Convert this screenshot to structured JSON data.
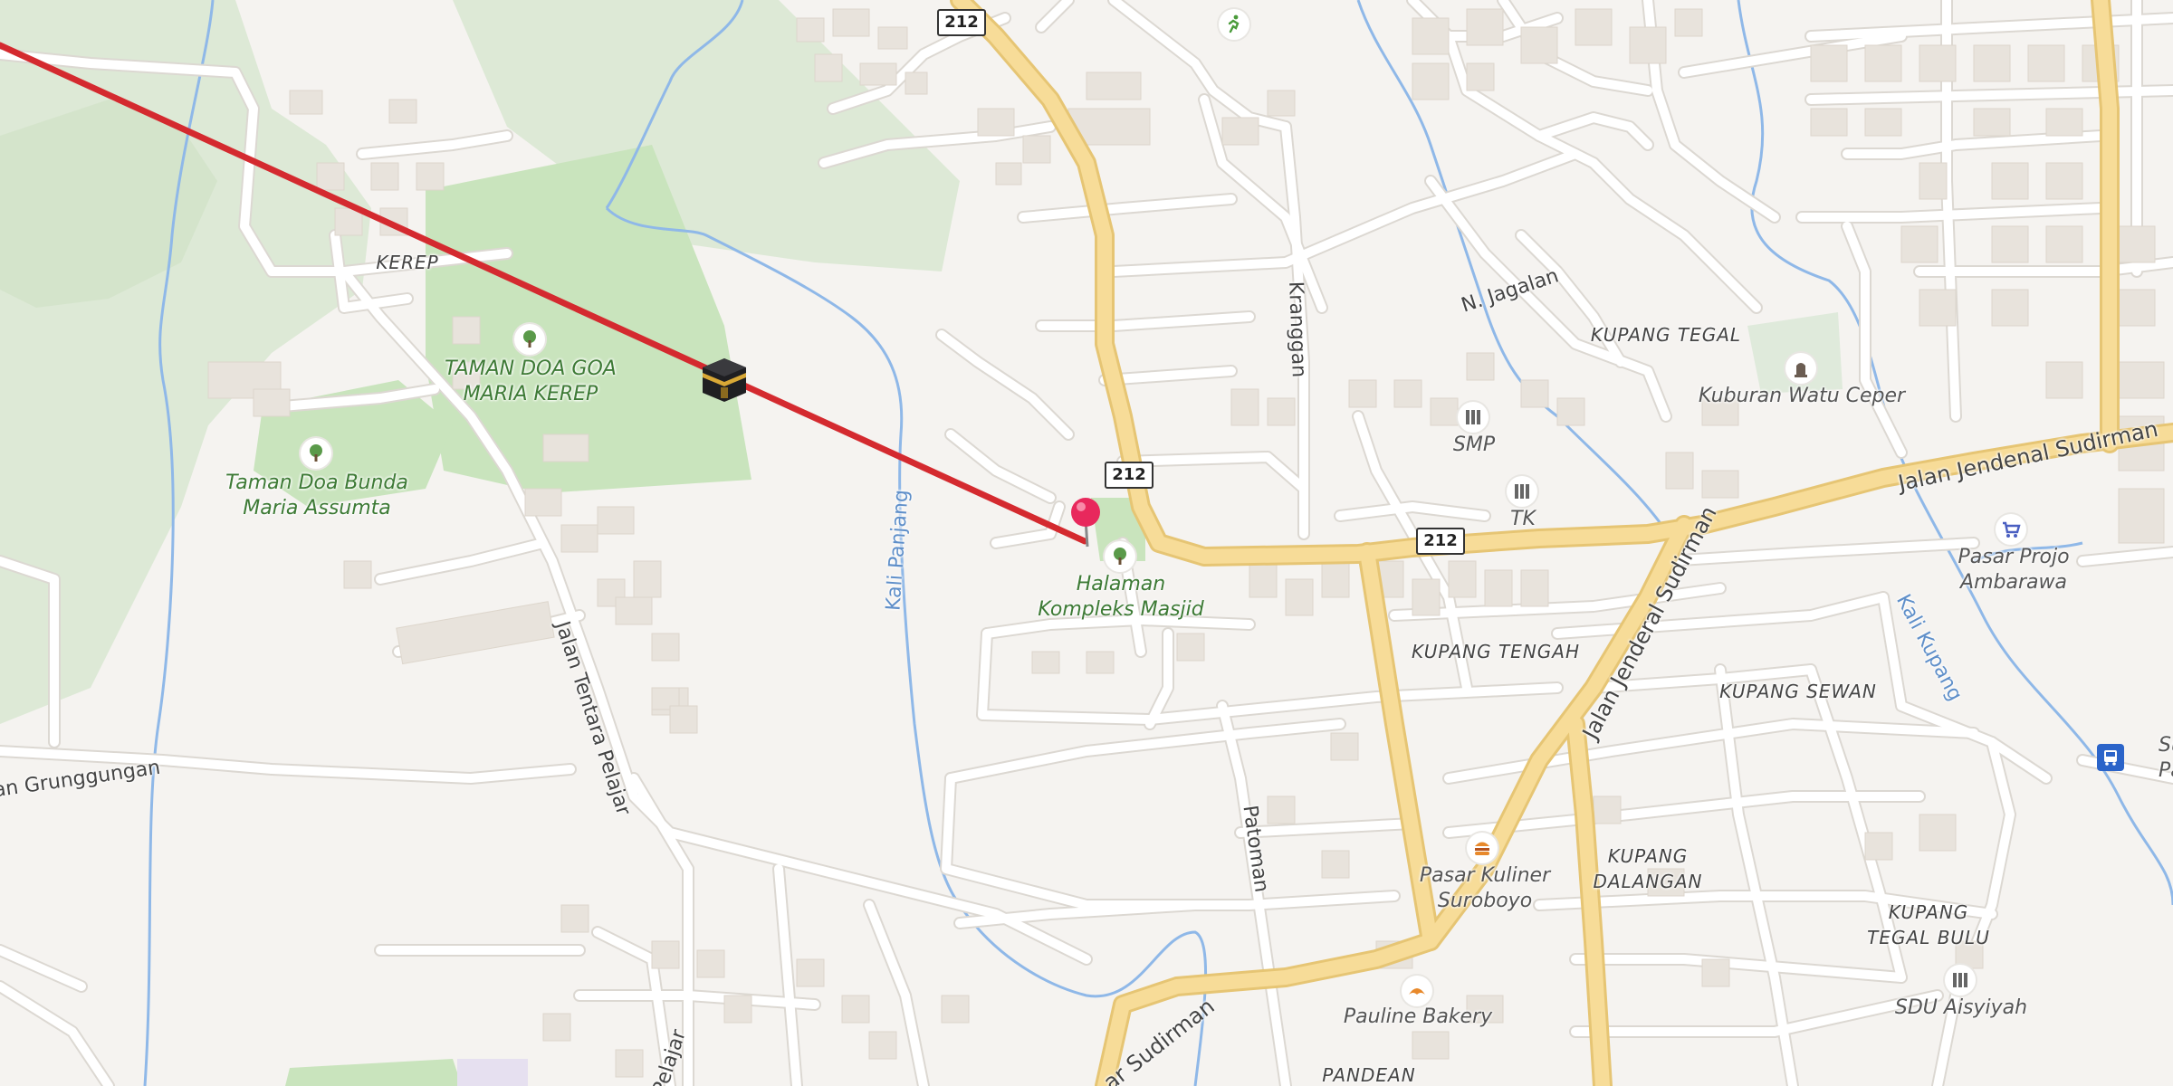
{
  "route_shields": [
    {
      "text": "212",
      "id": "shield-a"
    },
    {
      "text": "212",
      "id": "shield-b"
    },
    {
      "text": "212",
      "id": "shield-c"
    }
  ],
  "areas": {
    "kerep": "KEREP",
    "kupang_tegal": "KUPANG TEGAL",
    "kupang_tengah": "KUPANG TENGAH",
    "kupang_sewan": "KUPANG SEWAN",
    "kupang_dalangan": "KUPANG\nDALANGAN",
    "kupang_tegal_bulu": "KUPANG\nTEGAL BULU",
    "pandean": "PANDEAN"
  },
  "roads": {
    "jagalan": "N. Jagalan",
    "kranggan": "Kranggan",
    "jendsud_east": "Jalan Jendenal Sudirman",
    "jendsud_mid": "Jalan Jenderal Sudirman",
    "jendsud_sw": "ar Sudirman",
    "tentara": "Jalan Tentara Pelajar",
    "tentara_s": "Pelajar",
    "grunggungan": "lan Grunggungan",
    "patoman": "Patoman",
    "kali_panjang": "Kali Panjang",
    "kali_kupang": "Kali Kupang"
  },
  "pois": {
    "taman_goa": "TAMAN DOA GOA\nMARIA KEREP",
    "taman_bunda": "Taman Doa Bunda\nMaria Assumta",
    "halaman": "Halaman\nKompleks Masjid",
    "smp": "SMP",
    "tk": "TK",
    "kuburan": "Kuburan Watu Ceper",
    "pasar_projo": "Pasar Projo\nAmbarawa",
    "pasar_kuliner": "Pasar Kuliner\nSuroboyo",
    "pauline": "Pauline Bakery",
    "sdu": "SDU Aisyiyah",
    "sub_term": "Sub T\nPase"
  },
  "colors": {
    "background": "#f5f3f0",
    "forest": "#dde9d6",
    "park": "#c9e4bd",
    "major_road": "#f7dc98",
    "major_road_edge": "#e6c574",
    "minor_road": "#ffffff",
    "minor_road_edge": "#dcd8d2",
    "building": "#e8e3dc",
    "river": "#8fb8e8",
    "qibla_line": "#d42a2f",
    "pin": "#e8285c"
  },
  "icons": {
    "kaaba": "kaaba-icon",
    "pin": "location-pin-icon",
    "tree": "tree-icon",
    "school": "school-icon",
    "cemetery": "cemetery-icon",
    "market": "shopping-cart-icon",
    "food": "burger-icon",
    "bakery": "croissant-icon",
    "bus": "bus-icon",
    "sport": "running-person-icon"
  }
}
